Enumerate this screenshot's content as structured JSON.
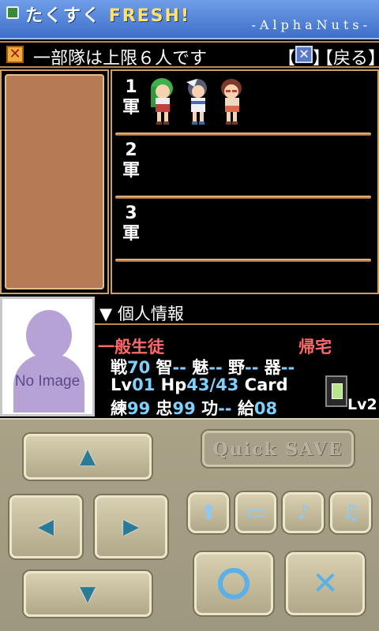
{
  "app": {
    "title_left": "たくすく",
    "title_right": "FRESH!",
    "brand": "-AlphaNuts-"
  },
  "header": {
    "close_icon": "✕",
    "message": "一部隊は上限６人です",
    "clear_button": "【",
    "clear_icon": "✕",
    "clear_close": "】",
    "back_button": "【戻る】"
  },
  "army": {
    "rows": [
      {
        "num": "1",
        "label": "軍"
      },
      {
        "num": "2",
        "label": "軍"
      },
      {
        "num": "3",
        "label": "軍"
      }
    ]
  },
  "profile": {
    "noimage": "No Image",
    "section_title": "▼ 個人情報",
    "class": "一般生徒",
    "status": "帰宅",
    "stats_row1": [
      {
        "label": "戦",
        "value": "70"
      },
      {
        "label": "智",
        "value": "--"
      },
      {
        "label": "魅",
        "value": "--"
      },
      {
        "label": "野",
        "value": "--"
      },
      {
        "label": "器",
        "value": "--"
      }
    ],
    "lv_label": "Lv",
    "lv_value": "01",
    "hp_label": "Hp",
    "hp_value": "43/43",
    "card_label": "Card",
    "card_level": "Lv2",
    "stats_row3": [
      {
        "label": "練",
        "value": "99"
      },
      {
        "label": "忠",
        "value": "99"
      },
      {
        "label": "功",
        "value": "--"
      },
      {
        "label": "給",
        "value": "08"
      }
    ]
  },
  "controls": {
    "quicksave": "Quick SAVE",
    "up_icon": "▲",
    "left_icon": "◀",
    "right_icon": "▶",
    "down_icon": "▼",
    "upload_icon": "⬆",
    "window_icon": "▭",
    "note_icon": "♪",
    "note_list_icon": "♫",
    "ok_icon": "○",
    "cancel_icon": "✕"
  }
}
